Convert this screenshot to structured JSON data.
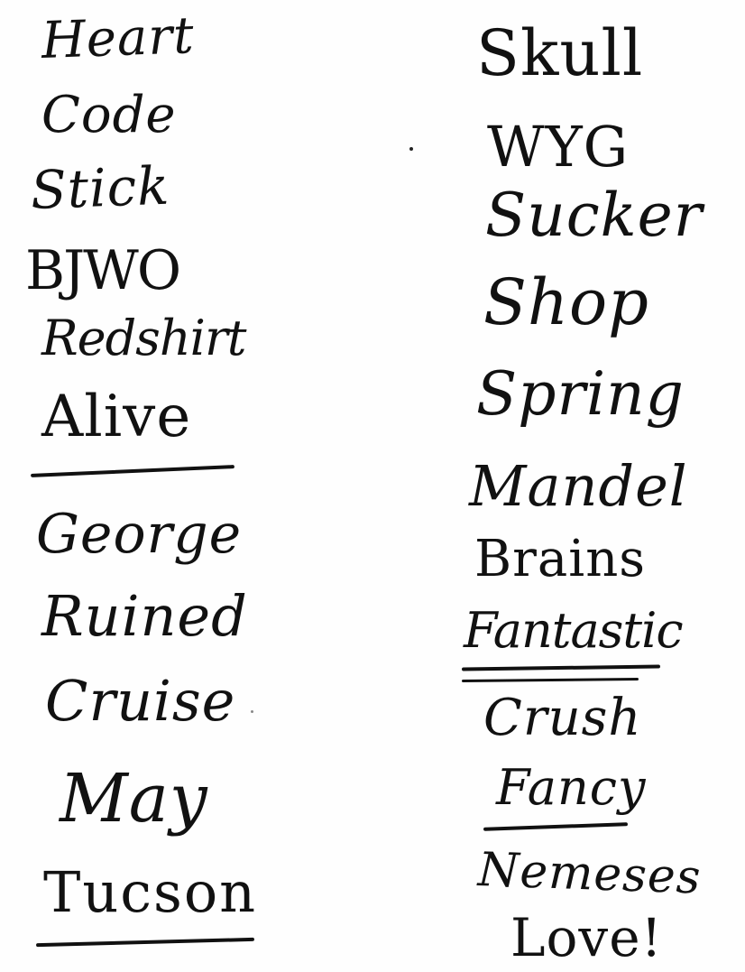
{
  "left_column": {
    "words": [
      "Heart",
      "Code",
      "Stick",
      "BJWO",
      "Redshirt",
      "Alive",
      "George",
      "Ruined",
      "Cruise",
      "May",
      "Tucson"
    ]
  },
  "right_column": {
    "words": [
      "Skull",
      "WYG",
      "Sucker",
      "Shop",
      "Spring",
      "Mandel",
      "Brains",
      "Fantastic",
      "Crush",
      "Fancy",
      "Nemeses",
      "Love!"
    ]
  },
  "ink_color": "#111111",
  "paper_color": "#fefefe"
}
